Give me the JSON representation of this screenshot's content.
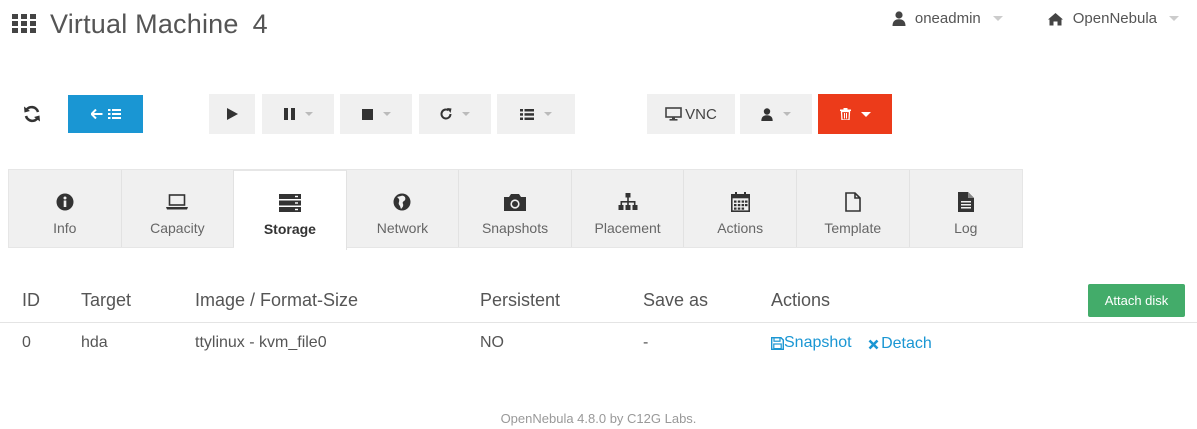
{
  "header": {
    "title": "Virtual Machine",
    "vm_id": "4",
    "user": "oneadmin",
    "zone": "OpenNebula",
    "icons": {
      "apps": "apps-grid-icon",
      "user": "user-icon",
      "zone": "home-icon"
    }
  },
  "toolbar": {
    "vnc_label": "VNC",
    "colors": {
      "back": "#1a96d3",
      "delete": "#ec3b1a"
    }
  },
  "tabs": [
    {
      "label": "Info",
      "icon": "info-icon"
    },
    {
      "label": "Capacity",
      "icon": "laptop-icon"
    },
    {
      "label": "Storage",
      "icon": "storage-icon",
      "active": true
    },
    {
      "label": "Network",
      "icon": "globe-icon"
    },
    {
      "label": "Snapshots",
      "icon": "camera-icon"
    },
    {
      "label": "Placement",
      "icon": "sitemap-icon"
    },
    {
      "label": "Actions",
      "icon": "calendar-icon"
    },
    {
      "label": "Template",
      "icon": "file-icon"
    },
    {
      "label": "Log",
      "icon": "file-text-icon"
    }
  ],
  "table": {
    "headers": [
      "ID",
      "Target",
      "Image / Format-Size",
      "Persistent",
      "Save as",
      "Actions"
    ],
    "attach_label": "Attach disk",
    "attach_color": "#43ac6a",
    "rows": [
      {
        "id": "0",
        "target": "hda",
        "image": "ttylinux - kvm_file0",
        "persistent": "NO",
        "save_as": "-",
        "snapshot_label": "Snapshot",
        "detach_label": "Detach"
      }
    ]
  },
  "footer": {
    "text": "OpenNebula 4.8.0 by C12G Labs."
  }
}
